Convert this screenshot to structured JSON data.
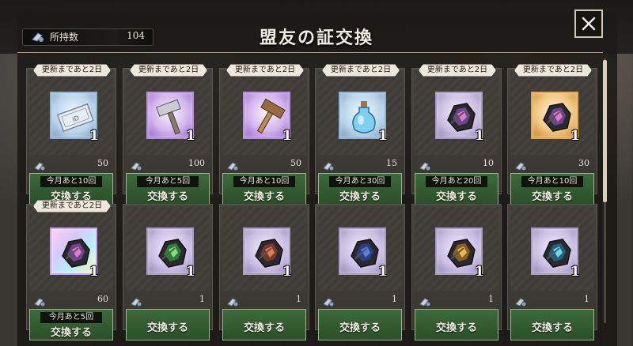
{
  "header": {
    "title": "盟友の証交換",
    "holdings_label": "所持数",
    "holdings_value": "104",
    "close_icon": "close-icon"
  },
  "items": [
    {
      "badge": "更新まであと2日",
      "icon": "ticket-icon",
      "frame": "blue",
      "qty": "1",
      "cost": "50",
      "limit": "今月あと10回",
      "action": "交換する"
    },
    {
      "badge": "更新まであと2日",
      "icon": "silver-hammer-icon",
      "frame": "purple",
      "qty": "1",
      "cost": "100",
      "limit": "今月あと5回",
      "action": "交換する"
    },
    {
      "badge": "更新まであと2日",
      "icon": "wood-hammer-icon",
      "frame": "purple",
      "qty": "1",
      "cost": "50",
      "limit": "今月あと10回",
      "action": "交換する"
    },
    {
      "badge": "更新まであと2日",
      "icon": "potion-icon",
      "frame": "blue",
      "qty": "1",
      "cost": "15",
      "limit": "今月あと30回",
      "action": "交換する"
    },
    {
      "badge": "更新まであと2日",
      "icon": "ore-icon",
      "frame": "plain",
      "qty": "1",
      "cost": "10",
      "limit": "今月あと20回",
      "action": "交換する"
    },
    {
      "badge": "更新まであと2日",
      "icon": "ore-icon",
      "frame": "gold",
      "qty": "1",
      "cost": "30",
      "limit": "今月あと10回",
      "action": "交換する"
    },
    {
      "badge": "更新まであと2日",
      "icon": "ore-icon",
      "frame": "rainbow",
      "qty": "1",
      "cost": "60",
      "limit": "今月あと5回",
      "action": "交換する"
    },
    {
      "badge": "",
      "icon": "green-ore-icon",
      "frame": "plain",
      "qty": "1",
      "cost": "1",
      "limit": "",
      "action": "交換する"
    },
    {
      "badge": "",
      "icon": "red-ore-icon",
      "frame": "plain",
      "qty": "1",
      "cost": "1",
      "limit": "",
      "action": "交換する"
    },
    {
      "badge": "",
      "icon": "blue-ore-icon",
      "frame": "plain",
      "qty": "1",
      "cost": "1",
      "limit": "",
      "action": "交換する"
    },
    {
      "badge": "",
      "icon": "yellow-ore-icon",
      "frame": "plain",
      "qty": "1",
      "cost": "1",
      "limit": "",
      "action": "交換する"
    },
    {
      "badge": "",
      "icon": "cyan-ore-icon",
      "frame": "plain",
      "qty": "1",
      "cost": "1",
      "limit": "",
      "action": "交換する"
    }
  ]
}
